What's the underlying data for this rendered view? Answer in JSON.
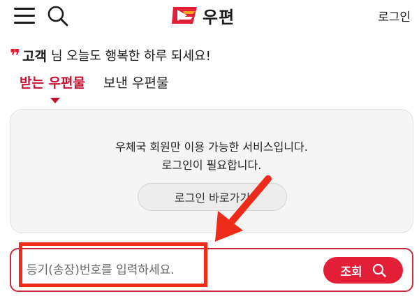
{
  "header": {
    "logo_text": "우편",
    "login_label": "로그인",
    "menu_icon": "hamburger-menu-icon",
    "search_icon": "search-icon"
  },
  "greeting": {
    "name": "고객",
    "message": "님 오늘도 행복한 하루 되세요!"
  },
  "tabs": [
    {
      "label": "받는 우편물",
      "active": true
    },
    {
      "label": "보낸 우편물",
      "active": false
    }
  ],
  "notice": {
    "line1": "우체국 회원만 이용 가능한 서비스입니다.",
    "line2": "로그인이 필요합니다.",
    "button_label": "로그인 바로가기"
  },
  "tracking": {
    "placeholder": "등기(송장)번호를 입력하세요.",
    "button_label": "조회",
    "button_icon": "search-icon"
  },
  "colors": {
    "brand_red": "#e31e37",
    "tab_active": "#c41230",
    "annotation_red": "#ee2a19"
  }
}
